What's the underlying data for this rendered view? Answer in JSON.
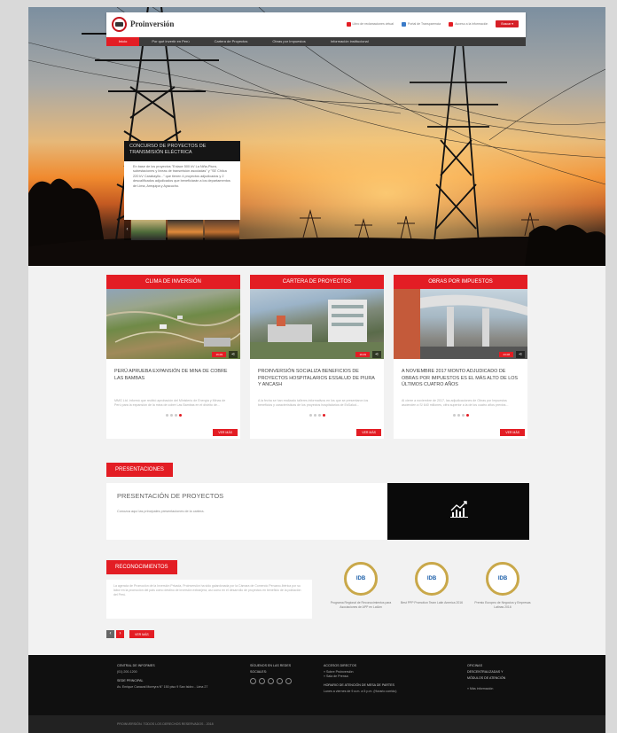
{
  "header": {
    "logo_text": "Proinversión",
    "logo_sub": "Agencia de Promoción de la Inversión Privada - Perú",
    "links": [
      {
        "label": "Libro de reclamaciones virtual",
        "icon": "plus-icon",
        "color": "#e31d24"
      },
      {
        "label": "Portal de Transparencia",
        "icon": "transparency-icon",
        "color": "#3a7bc8"
      },
      {
        "label": "Acceso a la información",
        "icon": "info-icon",
        "color": "#e31d24"
      }
    ],
    "button": "Buscar ▾"
  },
  "nav": [
    "Inicio",
    "Por qué invertir en Perú",
    "Cartera de Proyectos",
    "Obras por Impuestos",
    "Información institucional"
  ],
  "hero": {
    "title": "CONCURSO DE PROYECTOS DE TRANSMISIÓN ELÉCTRICA",
    "body": "En base de los proyectos \"Enlace 500 kV La Niña-Piura, subestaciones y líneas de transmisión asociadas\" y \"SE Chilca 220 kV Carabayllo...\" que tienen 4 proyectos adjudicados y 2 descalificados adjudicados que beneficiarán a los departamentos de Lima, Arequipa y Ayacucho."
  },
  "cards": [
    {
      "header": "Clima de inversión",
      "badge": "16.09",
      "title": "PERÚ APRUEBA EXPANSIÓN DE MINA DE COBRE LAS BAMBAS",
      "text": "MMG Ltd. informó que recibió aprobación del Ministerio de Energía y Minas de Perú para la expansión de la mina de cobre Las Bambas en el distrito de...",
      "button": "VER MÁS"
    },
    {
      "header": "Cartera de proyectos",
      "badge": "16.09",
      "title": "PROINVERSIÓN SOCIALIZA BENEFICIOS DE PROYECTOS HOSPITALARIOS ESSALUD DE PIURA Y ANCASH",
      "text": "A la fecha se han realizado talleres informativos en los que se presentaron los beneficios y características de los proyectos hospitalarios de EsSalud...",
      "button": "VER MÁS"
    },
    {
      "header": "Obras por impuestos",
      "badge": "23.08",
      "title": "A NOVIEMBRE 2017 MONTO ADJUDICADO DE OBRAS POR IMPUESTOS ES EL MÁS ALTO DE LOS ÚLTIMOS CUATRO AÑOS",
      "text": "Al cierre a noviembre de 2017, las adjudicaciones de Obras por Impuestos ascienden a S/ 640 millones, cifra superior a la de los cuatro años previos...",
      "button": "VER MÁS"
    }
  ],
  "presentaciones": {
    "tab": "Presentaciones",
    "title": "PRESENTACIÓN DE PROYECTOS",
    "subtitle": "Conozca aquí las principales presentaciones de la cartera."
  },
  "reconocimientos": {
    "tab": "Reconocimientos",
    "text": "La agencia de Promoción de la Inversión Privada, Proinversión ha sido galardonada por la Cámara de Comercio Peruano-Ibérica por su labor en la promoción del país como destino de inversión extranjera, así como en el desarrollo de proyectos en beneficio de la población del Perú.",
    "awards": [
      {
        "logo": "IDB",
        "caption": "Programa Regional de Reconocimientos para Asociaciones de APP en LatAm"
      },
      {
        "logo": "IDB",
        "caption": "Best PPP Promotion Team Latin America 2016"
      },
      {
        "logo": "IDB",
        "caption": "Premio Europeo de Negocios y Empresas Latinas 2016"
      }
    ],
    "prev": "‹",
    "next": "›",
    "view_more": "VER MÁS"
  },
  "footer": {
    "col1": {
      "h": "CENTRAL DE INFORMES",
      "lines": [
        "(01) 200-1200",
        "",
        "SEDE PRINCIPAL",
        "Av. Enrique Canaval Moreyra N° 150 piso 9 San Isidro - Lima 27"
      ]
    },
    "col2": {
      "h": "SÍGUENOS EN LAS REDES",
      "lines": [
        "SOCIALES:"
      ]
    },
    "col3": {
      "h": "ACCESOS DIRECTOS",
      "lines": [
        "» Sobre Proinversión",
        "» Sala de Prensa",
        "",
        "HORARIO DE ATENCIÓN DE MESA DE PARTES",
        "Lunes a viernes de 9 a.m. a 5 p.m. (Horario corrido)"
      ]
    },
    "col4": {
      "h": "OFICINAS",
      "lines": [
        "DESCENTRALIZADAS Y",
        "MÓDULOS DE ATENCIÓN",
        "",
        "» Más información"
      ]
    },
    "copyright": "PROINVERSIÓN. TODOS LOS DERECHOS RESERVADOS - 2018"
  }
}
